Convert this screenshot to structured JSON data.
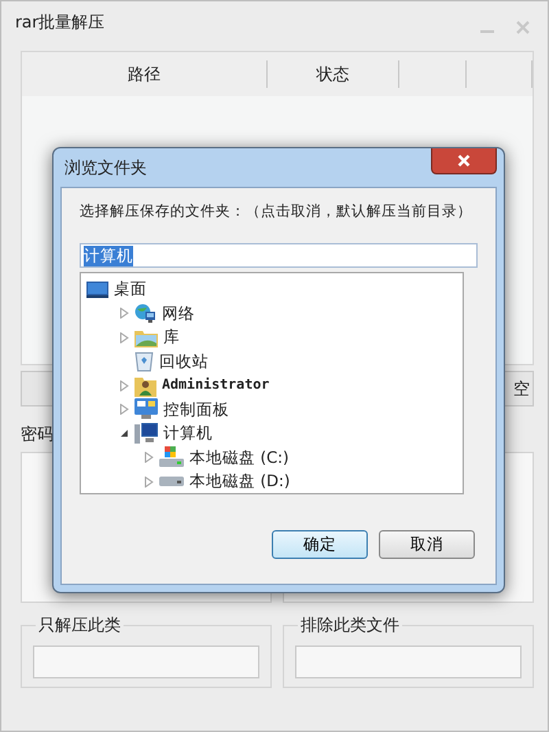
{
  "window": {
    "title": "rar批量解压"
  },
  "list": {
    "columns": [
      "路径",
      "状态",
      "",
      ""
    ]
  },
  "buttons": {
    "right_label": "空"
  },
  "password_label": "密码",
  "filters": [
    {
      "label": "只解压此类"
    },
    {
      "label": "排除此类文件"
    }
  ],
  "dialog": {
    "title": "浏览文件夹",
    "prompt": "选择解压保存的文件夹：（点击取消，默认解压当前目录）",
    "field": {
      "value": "计算机",
      "text_selected": true
    },
    "tree": [
      {
        "label": "桌面",
        "kind": "desktop",
        "children": [
          {
            "label": "网络",
            "kind": "network",
            "expanded": false
          },
          {
            "label": "库",
            "kind": "library",
            "expanded": false
          },
          {
            "label": "回收站",
            "kind": "recycle"
          },
          {
            "label": "Administrator",
            "kind": "user",
            "expanded": false
          },
          {
            "label": "控制面板",
            "kind": "control",
            "expanded": false
          },
          {
            "label": "计算机",
            "kind": "computer",
            "expanded": true,
            "children": [
              {
                "label": "本地磁盘 (C:)",
                "kind": "drive-system",
                "expanded": false
              },
              {
                "label": "本地磁盘 (D:)",
                "kind": "drive",
                "expanded": false
              }
            ]
          }
        ]
      }
    ],
    "buttons": [
      {
        "label": "确定",
        "default": true
      },
      {
        "label": "取消",
        "default": false
      }
    ]
  }
}
